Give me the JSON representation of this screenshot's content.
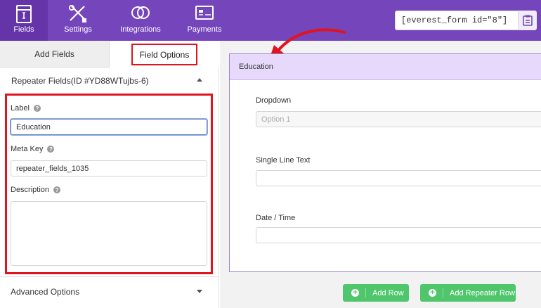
{
  "nav": {
    "items": [
      {
        "label": "Fields",
        "icon": "form-fields-icon"
      },
      {
        "label": "Settings",
        "icon": "tools-icon"
      },
      {
        "label": "Integrations",
        "icon": "integrations-icon"
      },
      {
        "label": "Payments",
        "icon": "payments-icon"
      }
    ],
    "shortcode": "[everest_form id=\"8\"]"
  },
  "tabs": {
    "add_fields": "Add Fields",
    "field_options": "Field Options"
  },
  "field_options": {
    "section_title": "Repeater Fields(ID #YD88WTujbs-6)",
    "label_label": "Label",
    "label_value": "Education",
    "meta_key_label": "Meta Key",
    "meta_key_value": "repeater_fields_1035",
    "description_label": "Description",
    "advanced_options": "Advanced Options"
  },
  "preview": {
    "header": "Education",
    "dropdown_label": "Dropdown",
    "dropdown_placeholder": "Option 1",
    "single_line_label": "Single Line Text",
    "date_label": "Date / Time",
    "add_row": "Add Row",
    "add_repeater_row": "Add Repeater Row"
  },
  "colors": {
    "brand": "#7545bb",
    "highlight": "#e0141e",
    "button": "#4fc66b",
    "header_bg": "#e6d9fb"
  }
}
